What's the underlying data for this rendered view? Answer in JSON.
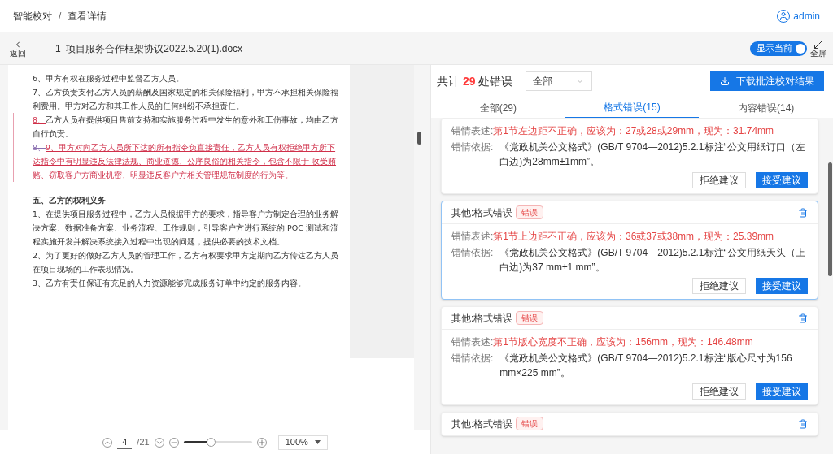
{
  "breadcrumb": {
    "items": [
      "智能校对",
      "查看详情"
    ],
    "separator": "/"
  },
  "user": {
    "name": "admin"
  },
  "toolbar": {
    "back_label": "返回",
    "file_name": "1_项目服务合作框架协议2022.5.20(1).docx",
    "toggle": {
      "label": "显示当前",
      "on": true
    },
    "fullscreen_label": "全屏"
  },
  "document": {
    "paragraphs": [
      {
        "kind": "normal",
        "changed": false,
        "segments": [
          {
            "kind": "normal",
            "text": "6、甲方有权在服务过程中监督乙方人员。"
          }
        ]
      },
      {
        "kind": "normal",
        "changed": false,
        "segments": [
          {
            "kind": "normal",
            "text": "7、乙方负责支付乙方人员的薪酬及国家规定的相关保险福利，甲方不承担相关保险福利费用。甲方对乙方和其工作人员的任何纠纷不承担责任。"
          }
        ]
      },
      {
        "kind": "normal",
        "changed": true,
        "segments": [
          {
            "kind": "inserted",
            "text": "8、"
          },
          {
            "kind": "normal",
            "text": "乙方人员在提供项目售前支持和实施服务过程中发生的意外和工伤事故，均由乙方自行负责。"
          }
        ]
      },
      {
        "kind": "normal",
        "changed": true,
        "segments": [
          {
            "kind": "deleted",
            "text": "8、"
          },
          {
            "kind": "inserted",
            "text": "9、甲方对向乙方人员所下达的所有指令负直接责任，乙方人员有权拒绝甲方所下达指令中有明显违反法律法规、商业道德、公序良俗的相关指令，包含不限于 收受贿赂、窃取客户方商业机密、明显违反客户方相关管理规范制度的行为等。"
          }
        ]
      },
      {
        "kind": "heading",
        "changed": false,
        "segments": [
          {
            "kind": "normal",
            "text": "五、乙方的权利义务"
          }
        ]
      },
      {
        "kind": "normal",
        "changed": false,
        "segments": [
          {
            "kind": "normal",
            "text": "1、在提供项目服务过程中，乙方人员根据甲方的要求，指导客户方制定合理的业务解决方案、数据准备方案、业务流程、工作规则，引导客户方进行系统的 POC 测试和流程实施开发并解决系统接入过程中出现的问题，提供必要的技术文档。"
          }
        ]
      },
      {
        "kind": "normal",
        "changed": false,
        "segments": [
          {
            "kind": "normal",
            "text": "2、为了更好的做好乙方人员的管理工作，乙方有权要求甲方定期向乙方传达乙方人员在项目现场的工作表现情况。"
          }
        ]
      },
      {
        "kind": "normal",
        "changed": false,
        "segments": [
          {
            "kind": "normal",
            "text": "3、乙方有责任保证有充足的人力资源能够完成服务订单中约定的服务内容。"
          }
        ]
      }
    ]
  },
  "pager": {
    "page": "4",
    "total": "/21",
    "level": 0.4,
    "zoom": "100%"
  },
  "summary": {
    "prefix": "共计",
    "count": "29",
    "suffix": "处错误",
    "filter": "全部",
    "download_button": "下载批注校对结果"
  },
  "tabs": [
    {
      "label": "全部(29)",
      "selected": false
    },
    {
      "label": "格式错误(15)",
      "selected": true
    },
    {
      "label": "内容错误(14)",
      "selected": false
    }
  ],
  "cards": [
    {
      "selected": false,
      "description_label": "错情表述:",
      "description": "第1节左边距不正确，应该为：27或28或29mm，现为：31.74mm",
      "basis_label": "错情依据:",
      "basis": "《党政机关公文格式》(GB/T 9704—2012)5.2.1标注“公文用纸订口（左白边)为28mm±1mm”。",
      "reject": "拒绝建议",
      "accept": "接受建议"
    },
    {
      "selected": true,
      "header": {
        "title": "其他:格式错误",
        "tag": "错误"
      },
      "description_label": "错情表述:",
      "description": "第1节上边距不正确，应该为：36或37或38mm，现为：25.39mm",
      "basis_label": "错情依据:",
      "basis": "《党政机关公文格式》(GB/T 9704—2012)5.2.1标注“公文用纸天头（上白边)为37 mm±1 mm”。",
      "reject": "拒绝建议",
      "accept": "接受建议"
    },
    {
      "selected": false,
      "header": {
        "title": "其他:格式错误",
        "tag": "错误"
      },
      "description_label": "错情表述:",
      "description": "第1节版心宽度不正确，应该为：156mm，现为：146.48mm",
      "basis_label": "错情依据:",
      "basis": "《党政机关公文格式》(GB/T 9704—2012)5.2.1标注“版心尺寸为156 mm×225 mm”。",
      "reject": "拒绝建议",
      "accept": "接受建议"
    },
    {
      "selected": false,
      "header": {
        "title": "其他:格式错误",
        "tag": "错误"
      }
    }
  ]
}
